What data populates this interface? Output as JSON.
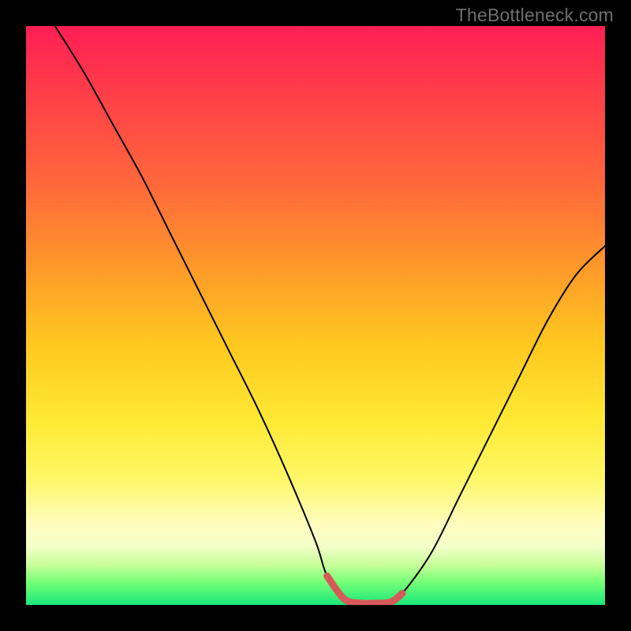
{
  "watermark": "TheBottleneck.com",
  "chart_data": {
    "type": "line",
    "title": "",
    "xlabel": "",
    "ylabel": "",
    "xlim": [
      0,
      100
    ],
    "ylim": [
      0,
      100
    ],
    "grid": false,
    "legend": false,
    "series": [
      {
        "name": "bottleneck-curve",
        "color": "#000000",
        "x": [
          5,
          10,
          15,
          20,
          25,
          30,
          35,
          40,
          45,
          50,
          52,
          55,
          58,
          60,
          63,
          65,
          70,
          75,
          80,
          85,
          90,
          95,
          100
        ],
        "y": [
          100,
          92,
          83,
          74,
          64,
          54,
          44,
          34,
          23,
          11,
          5,
          1,
          0.3,
          0.3,
          0.5,
          2,
          9,
          19,
          29,
          39,
          49,
          57,
          62
        ]
      },
      {
        "name": "valley-highlight",
        "color": "#d75a5a",
        "x": [
          52,
          55,
          58,
          60,
          63,
          65
        ],
        "y": [
          5,
          1,
          0.3,
          0.3,
          0.5,
          2
        ]
      }
    ],
    "gradient_stops": [
      {
        "pos": 0,
        "color": "#ff1e55"
      },
      {
        "pos": 10,
        "color": "#ff3a4a"
      },
      {
        "pos": 28,
        "color": "#ff6a3a"
      },
      {
        "pos": 42,
        "color": "#ff9a2a"
      },
      {
        "pos": 55,
        "color": "#ffc81f"
      },
      {
        "pos": 68,
        "color": "#ffe933"
      },
      {
        "pos": 78,
        "color": "#fff765"
      },
      {
        "pos": 86,
        "color": "#fffdbf"
      },
      {
        "pos": 90,
        "color": "#f3ffc8"
      },
      {
        "pos": 93,
        "color": "#c9ff9a"
      },
      {
        "pos": 96,
        "color": "#77ff77"
      },
      {
        "pos": 100,
        "color": "#18e87a"
      }
    ]
  }
}
